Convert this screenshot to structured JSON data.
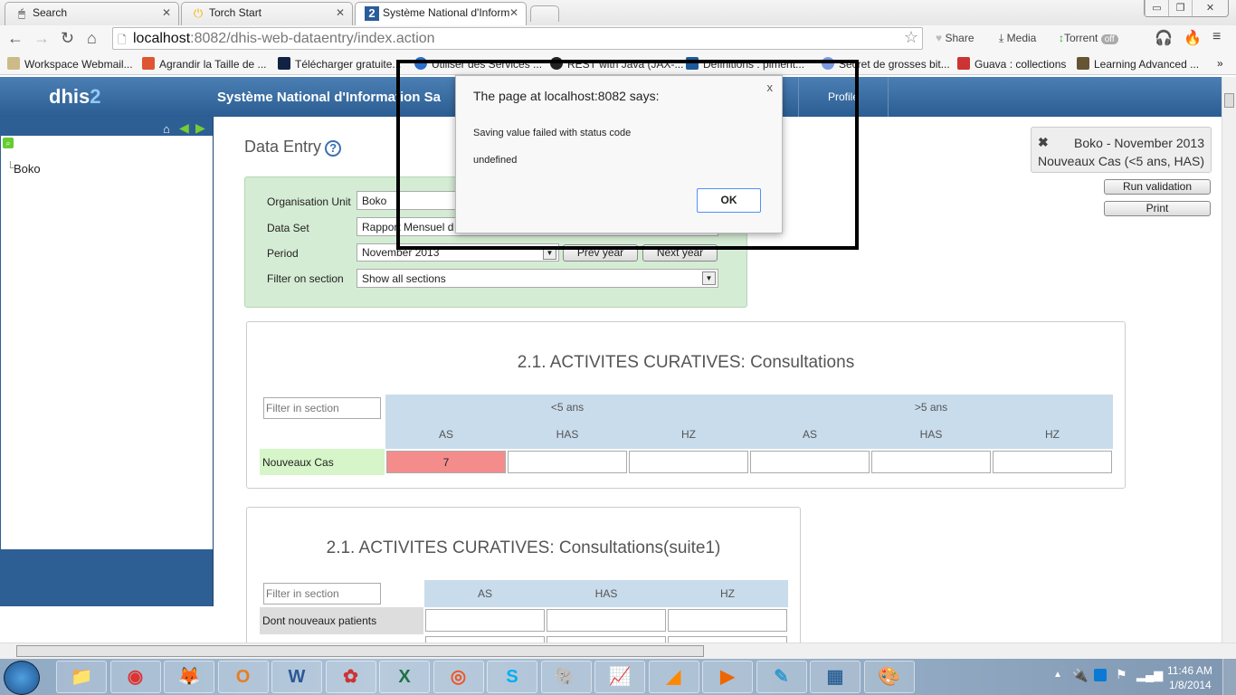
{
  "browser": {
    "tabs": [
      {
        "label": "Search",
        "icon": "mouse-icon"
      },
      {
        "label": "Torch Start",
        "icon": "power-icon"
      },
      {
        "label": "Système National d'Inform",
        "icon": "dhis-icon"
      }
    ],
    "url_host": "localhost",
    "url_rest": ":8082/dhis-web-dataentry/index.action",
    "extensions": {
      "share": "Share",
      "media": "Media",
      "torrent": "Torrent",
      "torrent_state": "off"
    },
    "bookmarks": [
      "Workspace Webmail...",
      "Agrandir la Taille de ...",
      "Télécharger gratuite...",
      "Utiliser des Services ...",
      "REST with Java (JAX-...",
      "Définitions : piment...",
      "Secret de grosses bit...",
      "Guava : collections",
      "Learning Advanced ..."
    ],
    "more": "»"
  },
  "app": {
    "logo_a": "dhis",
    "logo_b": "2",
    "title": "Système National d'Information Sa",
    "profile": "Profile"
  },
  "tree": {
    "root": "Boko"
  },
  "main": {
    "title": "Data Entry",
    "help": "?",
    "form": {
      "org_label": "Organisation Unit",
      "org_value": "Boko",
      "dataset_label": "Data Set",
      "dataset_value": "Rapport Mensuel d",
      "period_label": "Period",
      "period_value": "November 2013",
      "prev": "Prev year",
      "next": "Next year",
      "filter_label": "Filter on section",
      "filter_value": "Show all sections"
    },
    "notice": {
      "line1": "Boko - November 2013",
      "line2": "Nouveaux Cas (<5 ans, HAS)",
      "close": "✖"
    },
    "run_validation": "Run validation",
    "print": "Print",
    "section1": {
      "title": "2.1. ACTIVITES CURATIVES: Consultations",
      "filter_placeholder": "Filter in section",
      "groups": [
        "<5 ans",
        ">5 ans"
      ],
      "columns": [
        "AS",
        "HAS",
        "HZ",
        "AS",
        "HAS",
        "HZ"
      ],
      "rows": [
        {
          "label": "Nouveaux Cas",
          "values": [
            "7",
            "",
            "",
            "",
            "",
            ""
          ]
        }
      ],
      "error_color": "#f58c8c"
    },
    "section2": {
      "title": "2.1. ACTIVITES CURATIVES: Consultations(suite1)",
      "filter_placeholder": "Filter in section",
      "columns": [
        "AS",
        "HAS",
        "HZ"
      ],
      "rows": [
        {
          "label": "Dont nouveaux patients",
          "values": [
            "",
            "",
            ""
          ]
        }
      ]
    }
  },
  "dialog": {
    "title": "The page at localhost:8082 says:",
    "message1": "Saving value failed with status code",
    "message2": "undefined",
    "ok": "OK",
    "close": "x"
  },
  "taskbar": {
    "time": "11:46 AM",
    "date": "1/8/2014",
    "apps": [
      "explorer",
      "chrome",
      "firefox",
      "outlook",
      "word",
      "app",
      "excel",
      "firefox-dev",
      "skype",
      "postgresql",
      "chart-app",
      "orange-app",
      "media-player",
      "app2",
      "control-panel",
      "paint"
    ]
  }
}
